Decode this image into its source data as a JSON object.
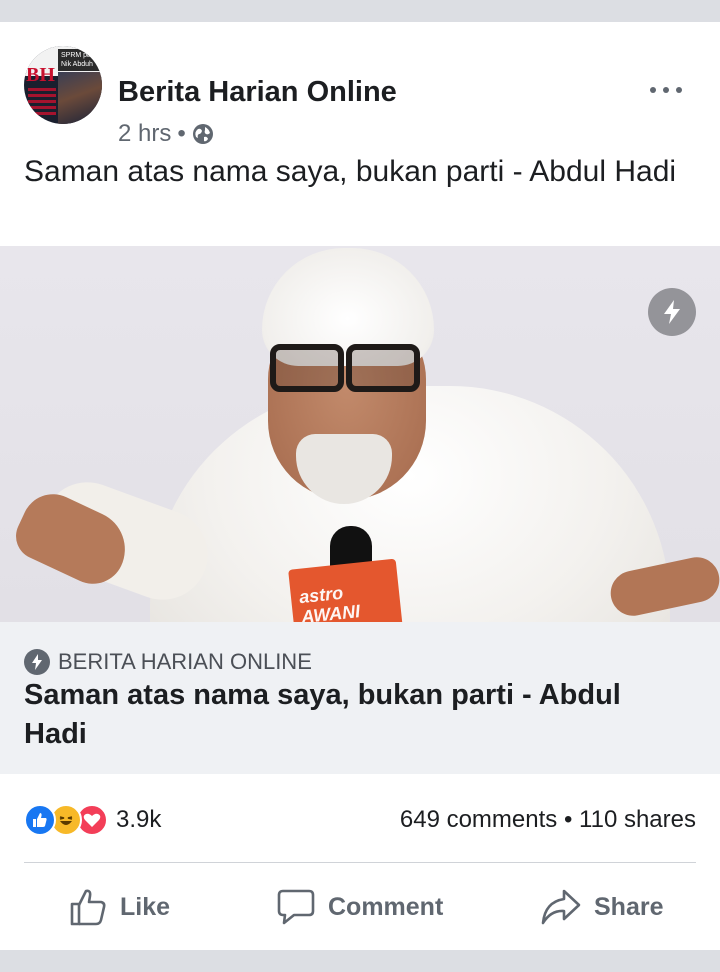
{
  "post": {
    "page_name": "Berita Harian Online",
    "time": "2 hrs",
    "separator": "•",
    "privacy_icon": "globe-icon",
    "message": "Saman atas nama saya, bukan parti - Abdul Hadi"
  },
  "avatar": {
    "logo_text": "BH",
    "thumb_text": "SPRM pa Nik Abduh"
  },
  "photo": {
    "mic_label": "astro AWANI",
    "badge_icon": "lightning-icon"
  },
  "link": {
    "source": "BERITA HARIAN ONLINE",
    "title": "Saman atas nama saya, bukan parti - Abdul Hadi",
    "source_icon": "lightning-icon"
  },
  "stats": {
    "reactions": [
      "like",
      "haha",
      "love"
    ],
    "reaction_count": "3.9k",
    "comments": "649 comments",
    "dot": "•",
    "shares": "110 shares"
  },
  "actions": {
    "like": "Like",
    "comment": "Comment",
    "share": "Share"
  },
  "colors": {
    "like_blue": "#1877f2",
    "haha_yellow": "#f7b928",
    "love_red": "#f33e58",
    "link_bg": "#eff1f4"
  }
}
